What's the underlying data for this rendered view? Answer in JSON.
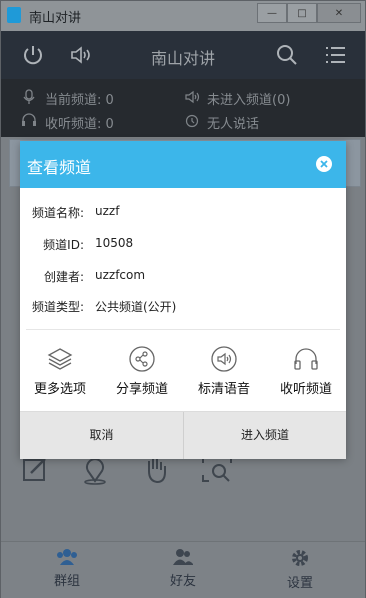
{
  "window": {
    "title": "南山对讲",
    "buttons": [
      "—",
      "□",
      "✕"
    ]
  },
  "header": {
    "title": "南山对讲",
    "icons": [
      "power-icon",
      "speaker-icon",
      "search-icon",
      "menu-icon"
    ]
  },
  "status": {
    "current_channel": "当前频道: 0",
    "listen_channel": "收听频道: 0",
    "not_entered": "未进入频道(0)",
    "nobody_speaking": "无人说话"
  },
  "dialog": {
    "title": "查看频道",
    "fields": [
      {
        "label": "频道名称:",
        "value": "uzzf"
      },
      {
        "label": "频道ID:",
        "value": "10508"
      },
      {
        "label": "创建者:",
        "value": "uzzfcom"
      },
      {
        "label": "频道类型:",
        "value": "公共频道(公开)"
      }
    ],
    "actions": [
      {
        "label": "更多选项",
        "icon": "layers-icon"
      },
      {
        "label": "分享频道",
        "icon": "share-icon"
      },
      {
        "label": "标清语音",
        "icon": "speaker-icon"
      },
      {
        "label": "收听频道",
        "icon": "headphones-icon"
      }
    ],
    "cancel": "取消",
    "enter": "进入频道"
  },
  "tabbar": {
    "tabs": [
      {
        "label": "群组",
        "icon": "group-icon"
      },
      {
        "label": "好友",
        "icon": "friends-icon"
      },
      {
        "label": "设置",
        "icon": "gear-icon"
      }
    ]
  },
  "colors": {
    "dialog_header": "#3cb6ea",
    "app_header": "#29303a"
  }
}
